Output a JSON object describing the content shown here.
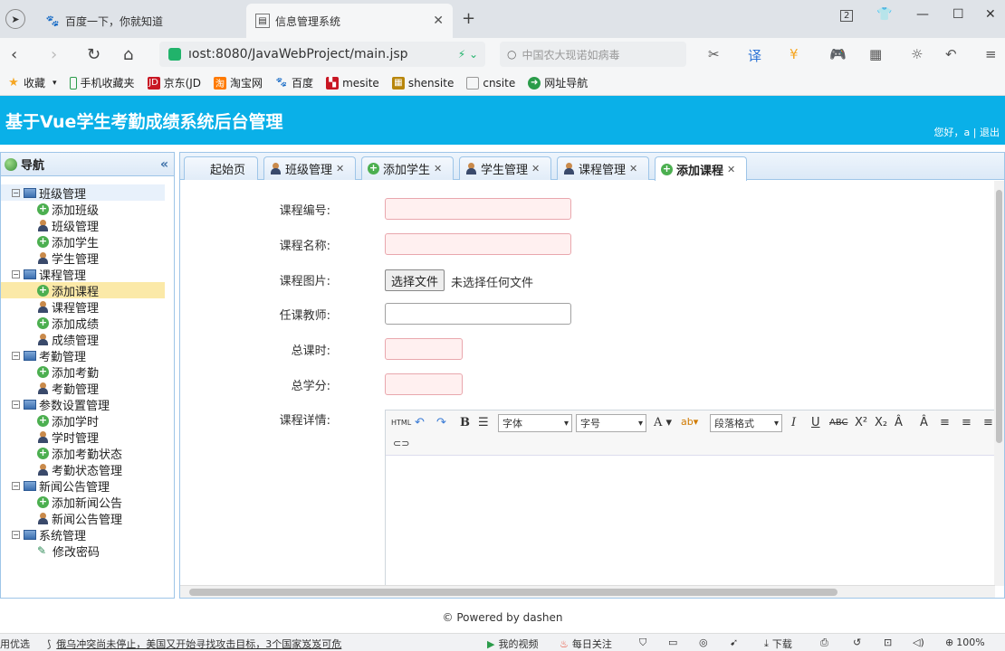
{
  "browser": {
    "tabs": [
      {
        "title": "百度一下，你就知道"
      },
      {
        "title": "信息管理系统"
      }
    ],
    "url": "ıost:8080/JavaWebProject/main.jsp",
    "search_placeholder": "中国农大现诺如病毒",
    "bookmarks": [
      "收藏",
      "手机收藏夹",
      "京东(JD",
      "淘宝网",
      "百度",
      "mesite",
      "shensite",
      "cnsite",
      "网址导航"
    ],
    "window_index": "2"
  },
  "app": {
    "title": "基于Vue学生考勤成绩系统后台管理",
    "greeting": "您好，a",
    "logout": "退出"
  },
  "sidebar": {
    "title": "导航",
    "groups": [
      {
        "label": "班级管理",
        "items": [
          {
            "label": "添加班级",
            "icon": "add"
          },
          {
            "label": "班级管理",
            "icon": "person"
          },
          {
            "label": "添加学生",
            "icon": "add"
          },
          {
            "label": "学生管理",
            "icon": "person"
          }
        ]
      },
      {
        "label": "课程管理",
        "items": [
          {
            "label": "添加课程",
            "icon": "add"
          },
          {
            "label": "课程管理",
            "icon": "person"
          },
          {
            "label": "添加成绩",
            "icon": "add"
          },
          {
            "label": "成绩管理",
            "icon": "person"
          }
        ]
      },
      {
        "label": "考勤管理",
        "items": [
          {
            "label": "添加考勤",
            "icon": "add"
          },
          {
            "label": "考勤管理",
            "icon": "person"
          }
        ]
      },
      {
        "label": "参数设置管理",
        "items": [
          {
            "label": "添加学时",
            "icon": "add"
          },
          {
            "label": "学时管理",
            "icon": "person"
          },
          {
            "label": "添加考勤状态",
            "icon": "add"
          },
          {
            "label": "考勤状态管理",
            "icon": "person"
          }
        ]
      },
      {
        "label": "新闻公告管理",
        "items": [
          {
            "label": "添加新闻公告",
            "icon": "add"
          },
          {
            "label": "新闻公告管理",
            "icon": "person"
          }
        ]
      },
      {
        "label": "系统管理",
        "items": [
          {
            "label": "修改密码",
            "icon": "pencil"
          }
        ]
      }
    ],
    "selected": "添加课程"
  },
  "content_tabs": [
    "起始页",
    "班级管理",
    "添加学生",
    "学生管理",
    "课程管理",
    "添加课程"
  ],
  "form": {
    "course_no_label": "课程编号:",
    "course_name_label": "课程名称:",
    "course_image_label": "课程图片:",
    "file_button": "选择文件",
    "file_status": "未选择任何文件",
    "teacher_label": "任课教师:",
    "total_hours_label": "总课时:",
    "total_credits_label": "总学分:",
    "detail_label": "课程详情:"
  },
  "editor": {
    "font_family": "字体",
    "font_size": "字号",
    "paragraph": "段落格式"
  },
  "footer": "© Powered by dashen",
  "statusbar": {
    "left_edge": "用优选",
    "news": "俄乌冲突尚未停止，美国又开始寻找攻击目标，3个国家岌岌可危",
    "video": "我的视频",
    "daily": "每日关注",
    "download": "下载",
    "zoom": "100%"
  }
}
